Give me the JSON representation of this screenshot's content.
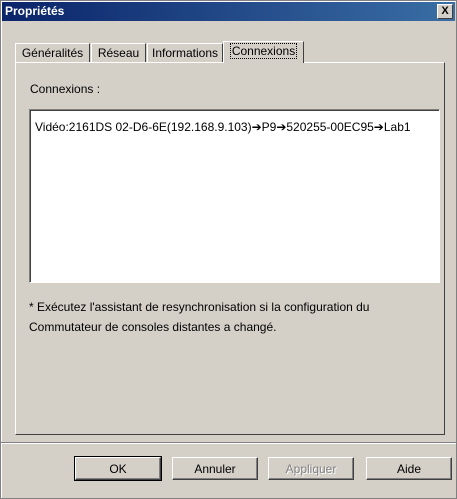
{
  "window": {
    "title": "Propriétés",
    "close_label": "X"
  },
  "tabs": [
    {
      "label": "Généralités",
      "active": false
    },
    {
      "label": "Réseau",
      "active": false
    },
    {
      "label": "Informations",
      "active": false
    },
    {
      "label": "Connexions",
      "active": true
    }
  ],
  "connections": {
    "label": "Connexions :",
    "entries": [
      "Vidéo:2161DS 02-D6-6E(192.168.9.103)➔P9➔520255-00EC95➔Lab1"
    ]
  },
  "note": {
    "line1": "* Exécutez l'assistant de resynchronisation si la configuration du",
    "line2": "Commutateur de consoles distantes a changé."
  },
  "buttons": {
    "ok": "OK",
    "cancel": "Annuler",
    "apply": "Appliquer",
    "help": "Aide"
  }
}
